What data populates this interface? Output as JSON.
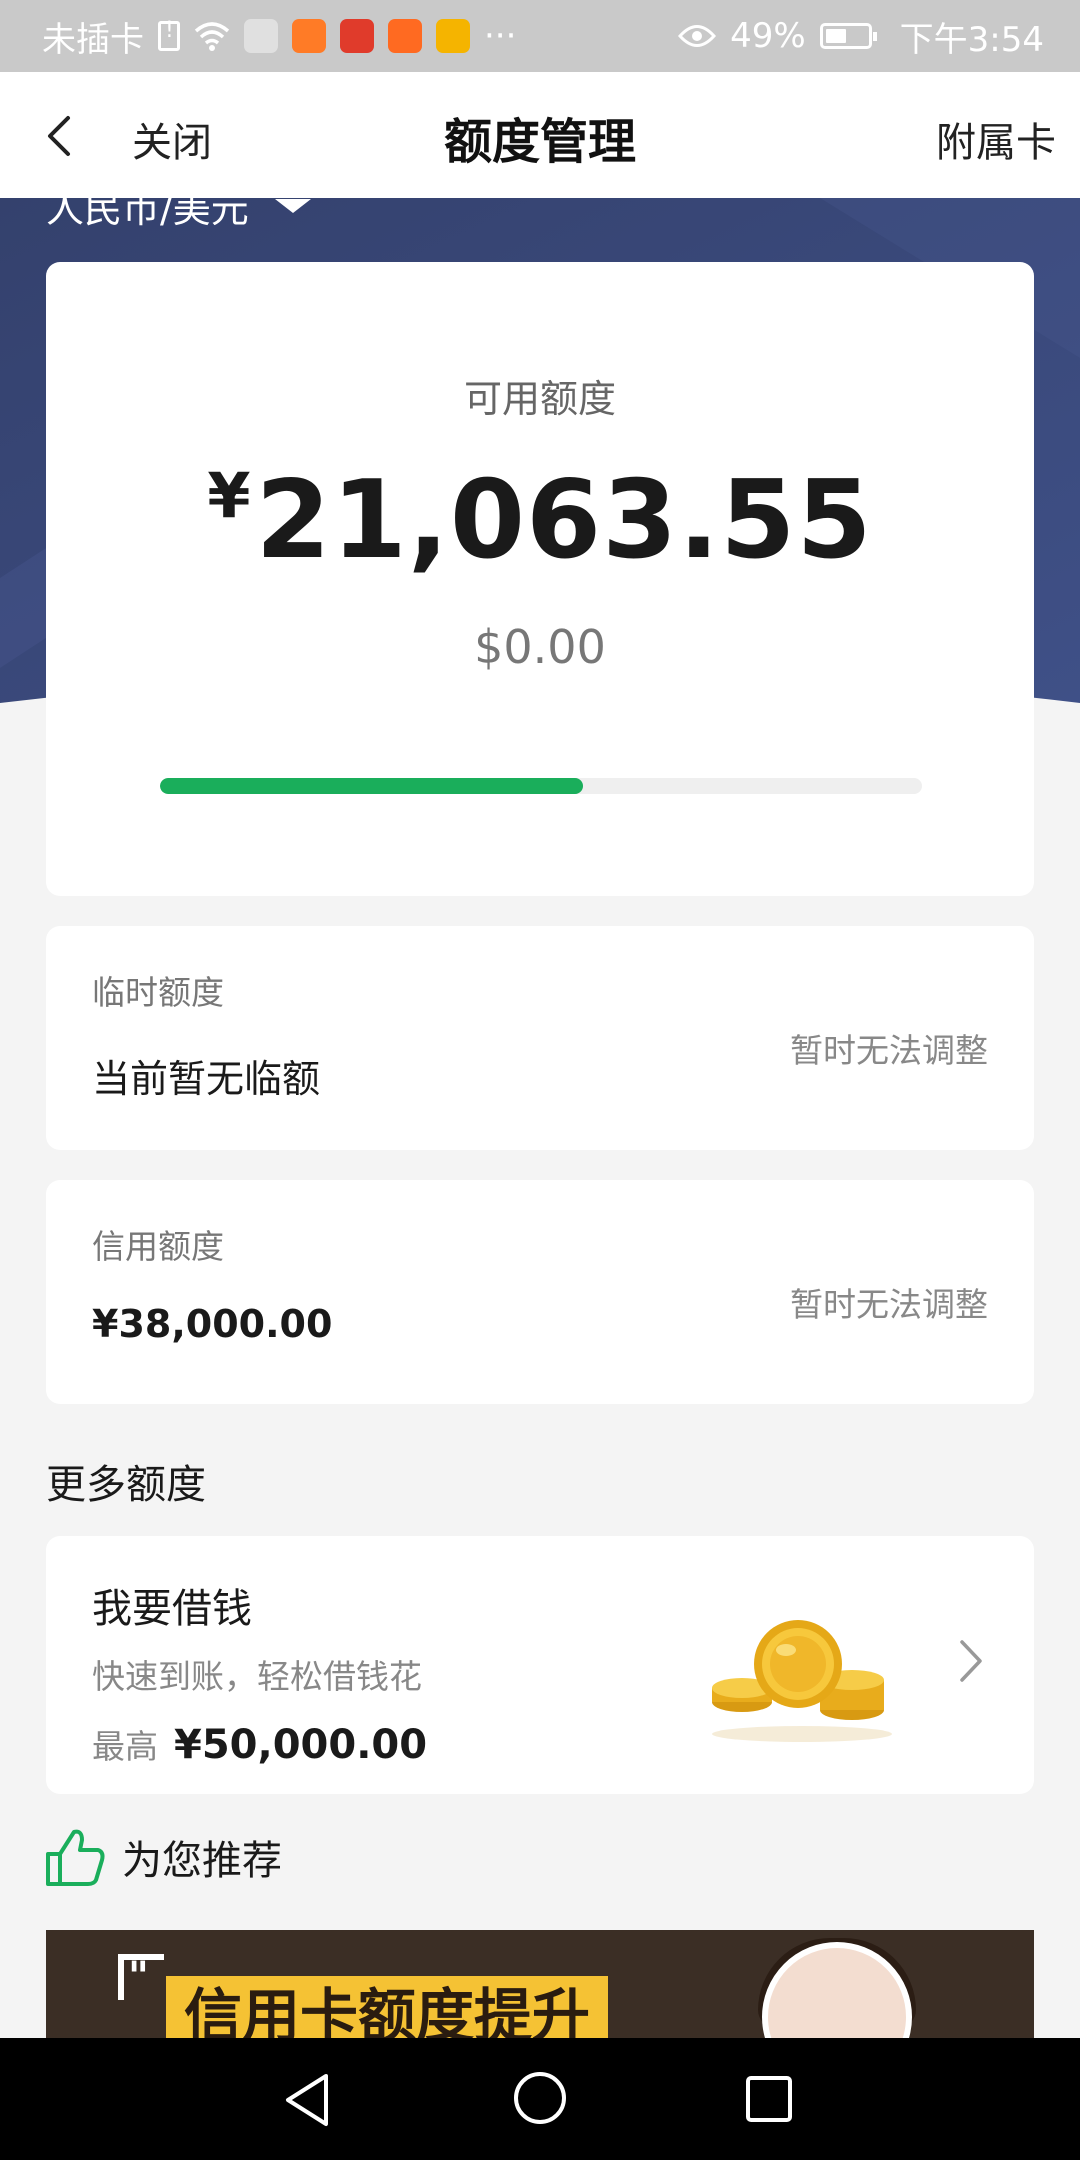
{
  "status_bar": {
    "left_text": "未插卡",
    "more": "···",
    "battery_percent_text": "49%",
    "battery_level": 0.49,
    "time": "下午3:54"
  },
  "nav": {
    "close_label": "关闭",
    "title": "额度管理",
    "right_label": "附属卡"
  },
  "currency_switch": {
    "label": "人民币/美元"
  },
  "available": {
    "label": "可用额度",
    "currency_symbol": "¥",
    "amount": "21,063.55",
    "usd_amount": "$0.00",
    "usage_fraction": 0.555
  },
  "temporary_limit": {
    "label": "临时额度",
    "value": "当前暂无临额",
    "action": "暂时无法调整"
  },
  "credit_limit": {
    "label": "信用额度",
    "value": "¥38,000.00",
    "action": "暂时无法调整"
  },
  "more_section": {
    "title": "更多额度"
  },
  "loan": {
    "title": "我要借钱",
    "subtitle": "快速到账，轻松借钱花",
    "max_label": "最高",
    "max_value": "¥50,000.00"
  },
  "recommend": {
    "title": "为您推荐"
  },
  "banner": {
    "headline": "信用卡额度提升"
  },
  "colors": {
    "hero_bg": "#3a4878",
    "progress_fill": "#1aae5b",
    "page_bg": "#f4f4f4"
  }
}
